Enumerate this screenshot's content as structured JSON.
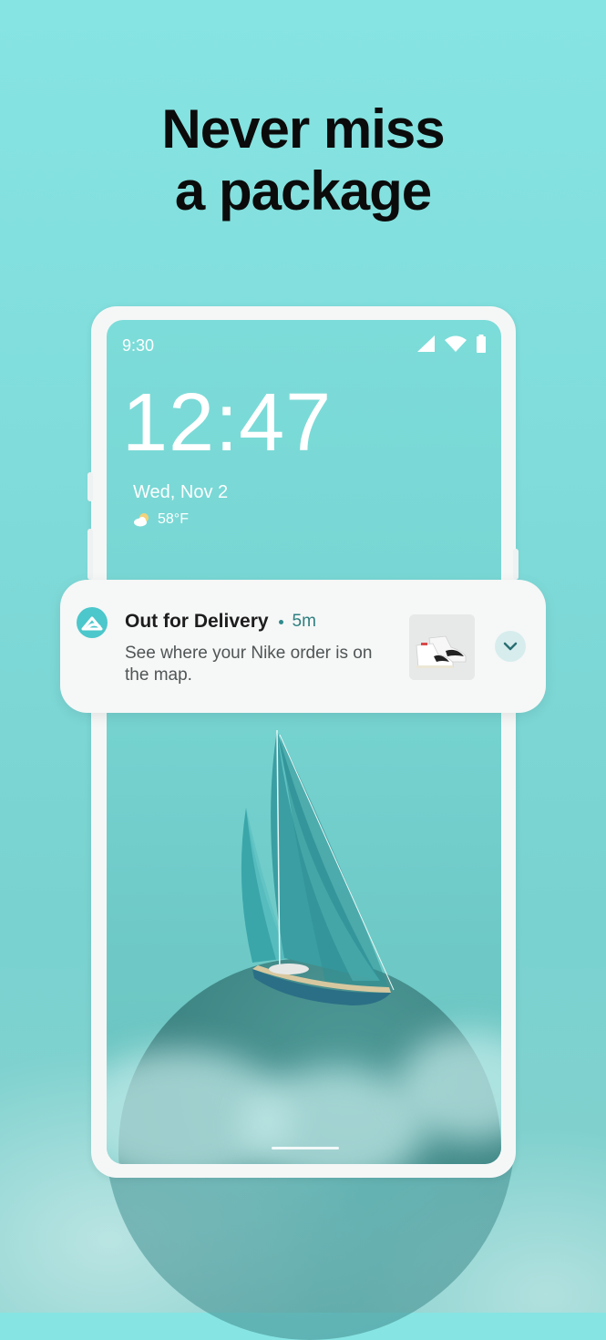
{
  "headline": {
    "line1": "Never miss",
    "line2": "a package"
  },
  "status_bar": {
    "time": "9:30",
    "icons": [
      "cellular-signal-icon",
      "wifi-icon",
      "battery-icon"
    ]
  },
  "lockscreen": {
    "clock": "12:47",
    "date": "Wed, Nov 2",
    "weather": {
      "icon": "partly-cloudy-icon",
      "temperature": "58°F"
    }
  },
  "notification": {
    "app_icon": "app-logo-icon",
    "title": "Out for Delivery",
    "time": "5m",
    "body": "See where your Nike order is on the map.",
    "thumbnail": "sneaker-image",
    "expand_icon": "chevron-down-icon"
  },
  "colors": {
    "background": "#7fdcda",
    "accent": "#4cc7cb",
    "headline_text": "#0b0b0b"
  }
}
